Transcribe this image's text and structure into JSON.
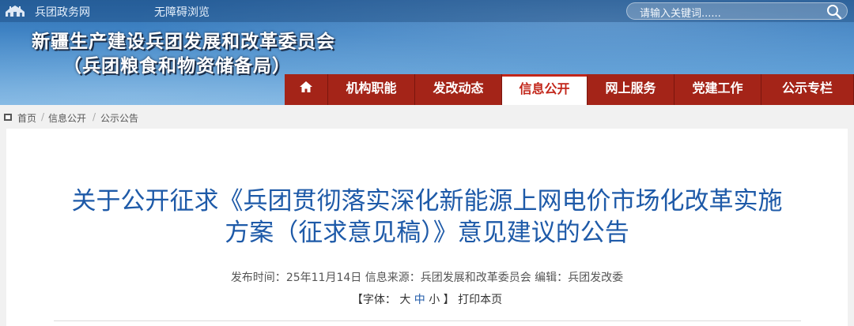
{
  "topbar": {
    "gov_link": "兵团政务网",
    "accessibility_link": "无障碍浏览",
    "search_placeholder": "请输入关键词......"
  },
  "site": {
    "title": "新疆生产建设兵团发展和改革委员会",
    "subtitle": "（兵团粮食和物资储备局）"
  },
  "nav": {
    "items": [
      {
        "label": "机构职能"
      },
      {
        "label": "发改动态"
      },
      {
        "label": "信息公开"
      },
      {
        "label": "网上服务"
      },
      {
        "label": "党建工作"
      },
      {
        "label": "公示专栏"
      }
    ],
    "active_index": 2
  },
  "breadcrumb": [
    "首页",
    "信息公开",
    "公示公告"
  ],
  "article": {
    "title_line1": "关于公开征求《兵团贯彻落实深化新能源上网电价市场化改革实施",
    "title_line2": "方案（征求意见稿）》意见建议的公告",
    "publish_label": "发布时间：",
    "publish_date": "25年11月14日",
    "source_label": "信息来源：",
    "source": "兵团发展和改革委员会",
    "editor_label": "编辑：",
    "editor": "兵团发改委",
    "font_label_open": "【字体：",
    "font_large": "大",
    "font_medium": "中",
    "font_small": "小",
    "font_label_close": "】",
    "print_label": "打印本页"
  },
  "colors": {
    "nav_bg": "#a42418",
    "nav_active_text": "#c2261a",
    "title_blue": "#1e5aa8"
  }
}
